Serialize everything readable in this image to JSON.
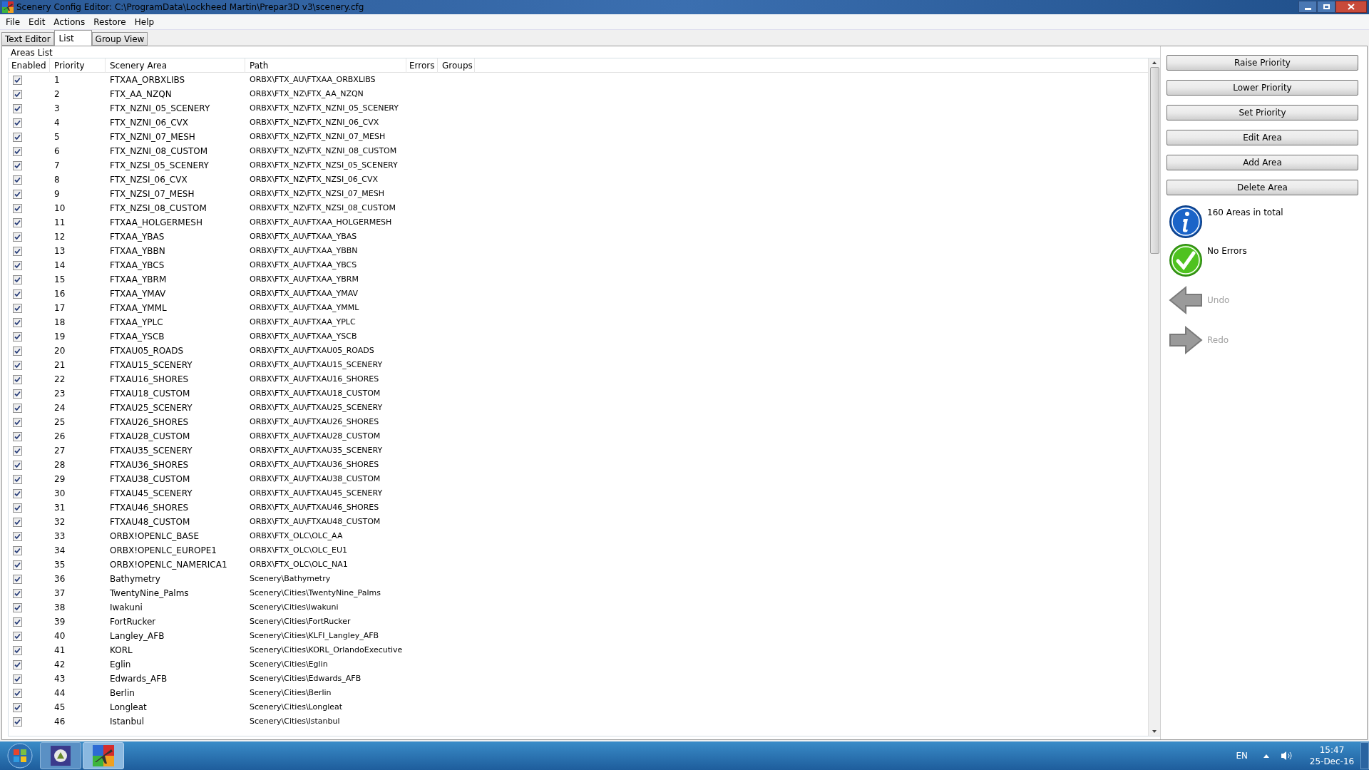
{
  "window": {
    "title": "Scenery Config Editor: C:\\ProgramData\\Lockheed Martin\\Prepar3D v3\\scenery.cfg"
  },
  "menu": [
    "File",
    "Edit",
    "Actions",
    "Restore",
    "Help"
  ],
  "tabs": [
    {
      "label": "Text Editor",
      "selected": false
    },
    {
      "label": "List",
      "selected": true
    },
    {
      "label": "Group View",
      "selected": false
    }
  ],
  "areas_list": {
    "label": "Areas List",
    "columns": [
      "Enabled",
      "Priority",
      "Scenery Area",
      "Path",
      "Errors",
      "Groups"
    ],
    "rows": [
      {
        "enabled": true,
        "priority": "1",
        "area": "FTXAA_ORBXLIBS",
        "path": "ORBX\\FTX_AU\\FTXAA_ORBXLIBS"
      },
      {
        "enabled": true,
        "priority": "2",
        "area": "FTX_AA_NZQN",
        "path": "ORBX\\FTX_NZ\\FTX_AA_NZQN"
      },
      {
        "enabled": true,
        "priority": "3",
        "area": "FTX_NZNI_05_SCENERY",
        "path": "ORBX\\FTX_NZ\\FTX_NZNI_05_SCENERY"
      },
      {
        "enabled": true,
        "priority": "4",
        "area": "FTX_NZNI_06_CVX",
        "path": "ORBX\\FTX_NZ\\FTX_NZNI_06_CVX"
      },
      {
        "enabled": true,
        "priority": "5",
        "area": "FTX_NZNI_07_MESH",
        "path": "ORBX\\FTX_NZ\\FTX_NZNI_07_MESH"
      },
      {
        "enabled": true,
        "priority": "6",
        "area": "FTX_NZNI_08_CUSTOM",
        "path": "ORBX\\FTX_NZ\\FTX_NZNI_08_CUSTOM"
      },
      {
        "enabled": true,
        "priority": "7",
        "area": "FTX_NZSI_05_SCENERY",
        "path": "ORBX\\FTX_NZ\\FTX_NZSI_05_SCENERY"
      },
      {
        "enabled": true,
        "priority": "8",
        "area": "FTX_NZSI_06_CVX",
        "path": "ORBX\\FTX_NZ\\FTX_NZSI_06_CVX"
      },
      {
        "enabled": true,
        "priority": "9",
        "area": "FTX_NZSI_07_MESH",
        "path": "ORBX\\FTX_NZ\\FTX_NZSI_07_MESH"
      },
      {
        "enabled": true,
        "priority": "10",
        "area": "FTX_NZSI_08_CUSTOM",
        "path": "ORBX\\FTX_NZ\\FTX_NZSI_08_CUSTOM"
      },
      {
        "enabled": true,
        "priority": "11",
        "area": "FTXAA_HOLGERMESH",
        "path": "ORBX\\FTX_AU\\FTXAA_HOLGERMESH"
      },
      {
        "enabled": true,
        "priority": "12",
        "area": "FTXAA_YBAS",
        "path": "ORBX\\FTX_AU\\FTXAA_YBAS"
      },
      {
        "enabled": true,
        "priority": "13",
        "area": "FTXAA_YBBN",
        "path": "ORBX\\FTX_AU\\FTXAA_YBBN"
      },
      {
        "enabled": true,
        "priority": "14",
        "area": "FTXAA_YBCS",
        "path": "ORBX\\FTX_AU\\FTXAA_YBCS"
      },
      {
        "enabled": true,
        "priority": "15",
        "area": "FTXAA_YBRM",
        "path": "ORBX\\FTX_AU\\FTXAA_YBRM"
      },
      {
        "enabled": true,
        "priority": "16",
        "area": "FTXAA_YMAV",
        "path": "ORBX\\FTX_AU\\FTXAA_YMAV"
      },
      {
        "enabled": true,
        "priority": "17",
        "area": "FTXAA_YMML",
        "path": "ORBX\\FTX_AU\\FTXAA_YMML"
      },
      {
        "enabled": true,
        "priority": "18",
        "area": "FTXAA_YPLC",
        "path": "ORBX\\FTX_AU\\FTXAA_YPLC"
      },
      {
        "enabled": true,
        "priority": "19",
        "area": "FTXAA_YSCB",
        "path": "ORBX\\FTX_AU\\FTXAA_YSCB"
      },
      {
        "enabled": true,
        "priority": "20",
        "area": "FTXAU05_ROADS",
        "path": "ORBX\\FTX_AU\\FTXAU05_ROADS"
      },
      {
        "enabled": true,
        "priority": "21",
        "area": "FTXAU15_SCENERY",
        "path": "ORBX\\FTX_AU\\FTXAU15_SCENERY"
      },
      {
        "enabled": true,
        "priority": "22",
        "area": "FTXAU16_SHORES",
        "path": "ORBX\\FTX_AU\\FTXAU16_SHORES"
      },
      {
        "enabled": true,
        "priority": "23",
        "area": "FTXAU18_CUSTOM",
        "path": "ORBX\\FTX_AU\\FTXAU18_CUSTOM"
      },
      {
        "enabled": true,
        "priority": "24",
        "area": "FTXAU25_SCENERY",
        "path": "ORBX\\FTX_AU\\FTXAU25_SCENERY"
      },
      {
        "enabled": true,
        "priority": "25",
        "area": "FTXAU26_SHORES",
        "path": "ORBX\\FTX_AU\\FTXAU26_SHORES"
      },
      {
        "enabled": true,
        "priority": "26",
        "area": "FTXAU28_CUSTOM",
        "path": "ORBX\\FTX_AU\\FTXAU28_CUSTOM"
      },
      {
        "enabled": true,
        "priority": "27",
        "area": "FTXAU35_SCENERY",
        "path": "ORBX\\FTX_AU\\FTXAU35_SCENERY"
      },
      {
        "enabled": true,
        "priority": "28",
        "area": "FTXAU36_SHORES",
        "path": "ORBX\\FTX_AU\\FTXAU36_SHORES"
      },
      {
        "enabled": true,
        "priority": "29",
        "area": "FTXAU38_CUSTOM",
        "path": "ORBX\\FTX_AU\\FTXAU38_CUSTOM"
      },
      {
        "enabled": true,
        "priority": "30",
        "area": "FTXAU45_SCENERY",
        "path": "ORBX\\FTX_AU\\FTXAU45_SCENERY"
      },
      {
        "enabled": true,
        "priority": "31",
        "area": "FTXAU46_SHORES",
        "path": "ORBX\\FTX_AU\\FTXAU46_SHORES"
      },
      {
        "enabled": true,
        "priority": "32",
        "area": "FTXAU48_CUSTOM",
        "path": "ORBX\\FTX_AU\\FTXAU48_CUSTOM"
      },
      {
        "enabled": true,
        "priority": "33",
        "area": "ORBX!OPENLC_BASE",
        "path": "ORBX\\FTX_OLC\\OLC_AA"
      },
      {
        "enabled": true,
        "priority": "34",
        "area": "ORBX!OPENLC_EUROPE1",
        "path": "ORBX\\FTX_OLC\\OLC_EU1"
      },
      {
        "enabled": true,
        "priority": "35",
        "area": "ORBX!OPENLC_NAMERICA1",
        "path": "ORBX\\FTX_OLC\\OLC_NA1"
      },
      {
        "enabled": true,
        "priority": "36",
        "area": "Bathymetry",
        "path": "Scenery\\Bathymetry"
      },
      {
        "enabled": true,
        "priority": "37",
        "area": "TwentyNine_Palms",
        "path": "Scenery\\Cities\\TwentyNine_Palms"
      },
      {
        "enabled": true,
        "priority": "38",
        "area": "Iwakuni",
        "path": "Scenery\\Cities\\Iwakuni"
      },
      {
        "enabled": true,
        "priority": "39",
        "area": "FortRucker",
        "path": "Scenery\\Cities\\FortRucker"
      },
      {
        "enabled": true,
        "priority": "40",
        "area": "Langley_AFB",
        "path": "Scenery\\Cities\\KLFI_Langley_AFB"
      },
      {
        "enabled": true,
        "priority": "41",
        "area": "KORL",
        "path": "Scenery\\Cities\\KORL_OrlandoExecutive"
      },
      {
        "enabled": true,
        "priority": "42",
        "area": "Eglin",
        "path": "Scenery\\Cities\\Eglin"
      },
      {
        "enabled": true,
        "priority": "43",
        "area": "Edwards_AFB",
        "path": "Scenery\\Cities\\Edwards_AFB"
      },
      {
        "enabled": true,
        "priority": "44",
        "area": "Berlin",
        "path": "Scenery\\Cities\\Berlin"
      },
      {
        "enabled": true,
        "priority": "45",
        "area": "Longleat",
        "path": "Scenery\\Cities\\Longleat"
      },
      {
        "enabled": true,
        "priority": "46",
        "area": "Istanbul",
        "path": "Scenery\\Cities\\Istanbul"
      }
    ]
  },
  "actions": [
    "Raise Priority",
    "Lower Priority",
    "Set Priority",
    "Edit Area",
    "Add Area",
    "Delete Area"
  ],
  "status": [
    {
      "kind": "info",
      "text": "160 Areas in total"
    },
    {
      "kind": "success",
      "text": "No Errors"
    }
  ],
  "history": [
    {
      "kind": "undo",
      "label": "Undo",
      "disabled": true
    },
    {
      "kind": "redo",
      "label": "Redo",
      "disabled": true
    }
  ],
  "taskbar": {
    "language": "EN",
    "time": "15:47",
    "date": "25-Dec-16"
  }
}
